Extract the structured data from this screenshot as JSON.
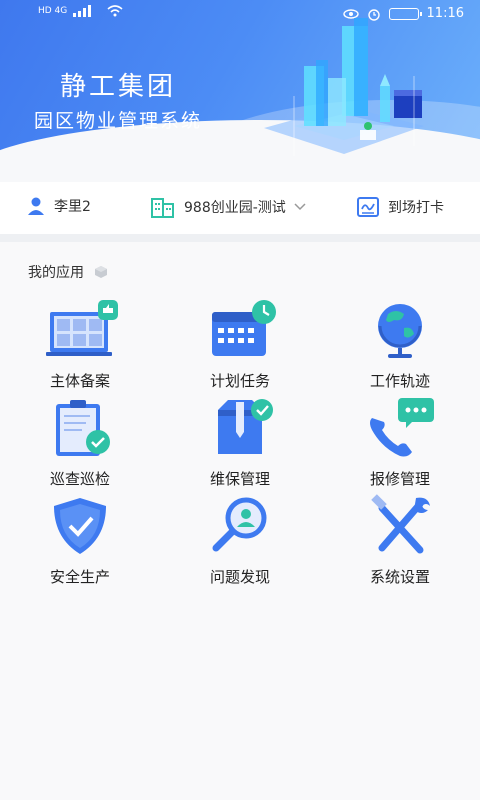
{
  "status": {
    "network_left": "HD 4G",
    "time": "11:16"
  },
  "header": {
    "title": "静工集团",
    "subtitle": "园区物业管理系统"
  },
  "info": {
    "user": "李里2",
    "park": "988创业园-测试",
    "checkin": "到场打卡"
  },
  "apps_title": "我的应用",
  "apps": [
    {
      "label": "主体备案",
      "icon": "registry-icon"
    },
    {
      "label": "计划任务",
      "icon": "calendar-clock-icon"
    },
    {
      "label": "工作轨迹",
      "icon": "globe-icon"
    },
    {
      "label": "巡查巡检",
      "icon": "clipboard-check-icon"
    },
    {
      "label": "维保管理",
      "icon": "maintenance-box-icon"
    },
    {
      "label": "报修管理",
      "icon": "phone-message-icon"
    },
    {
      "label": "安全生产",
      "icon": "shield-check-icon"
    },
    {
      "label": "问题发现",
      "icon": "search-user-icon"
    },
    {
      "label": "系统设置",
      "icon": "tools-icon"
    }
  ],
  "colors": {
    "primary": "#3f78ee",
    "icon_blue": "#3e7af0",
    "green": "#2fc2a6"
  }
}
